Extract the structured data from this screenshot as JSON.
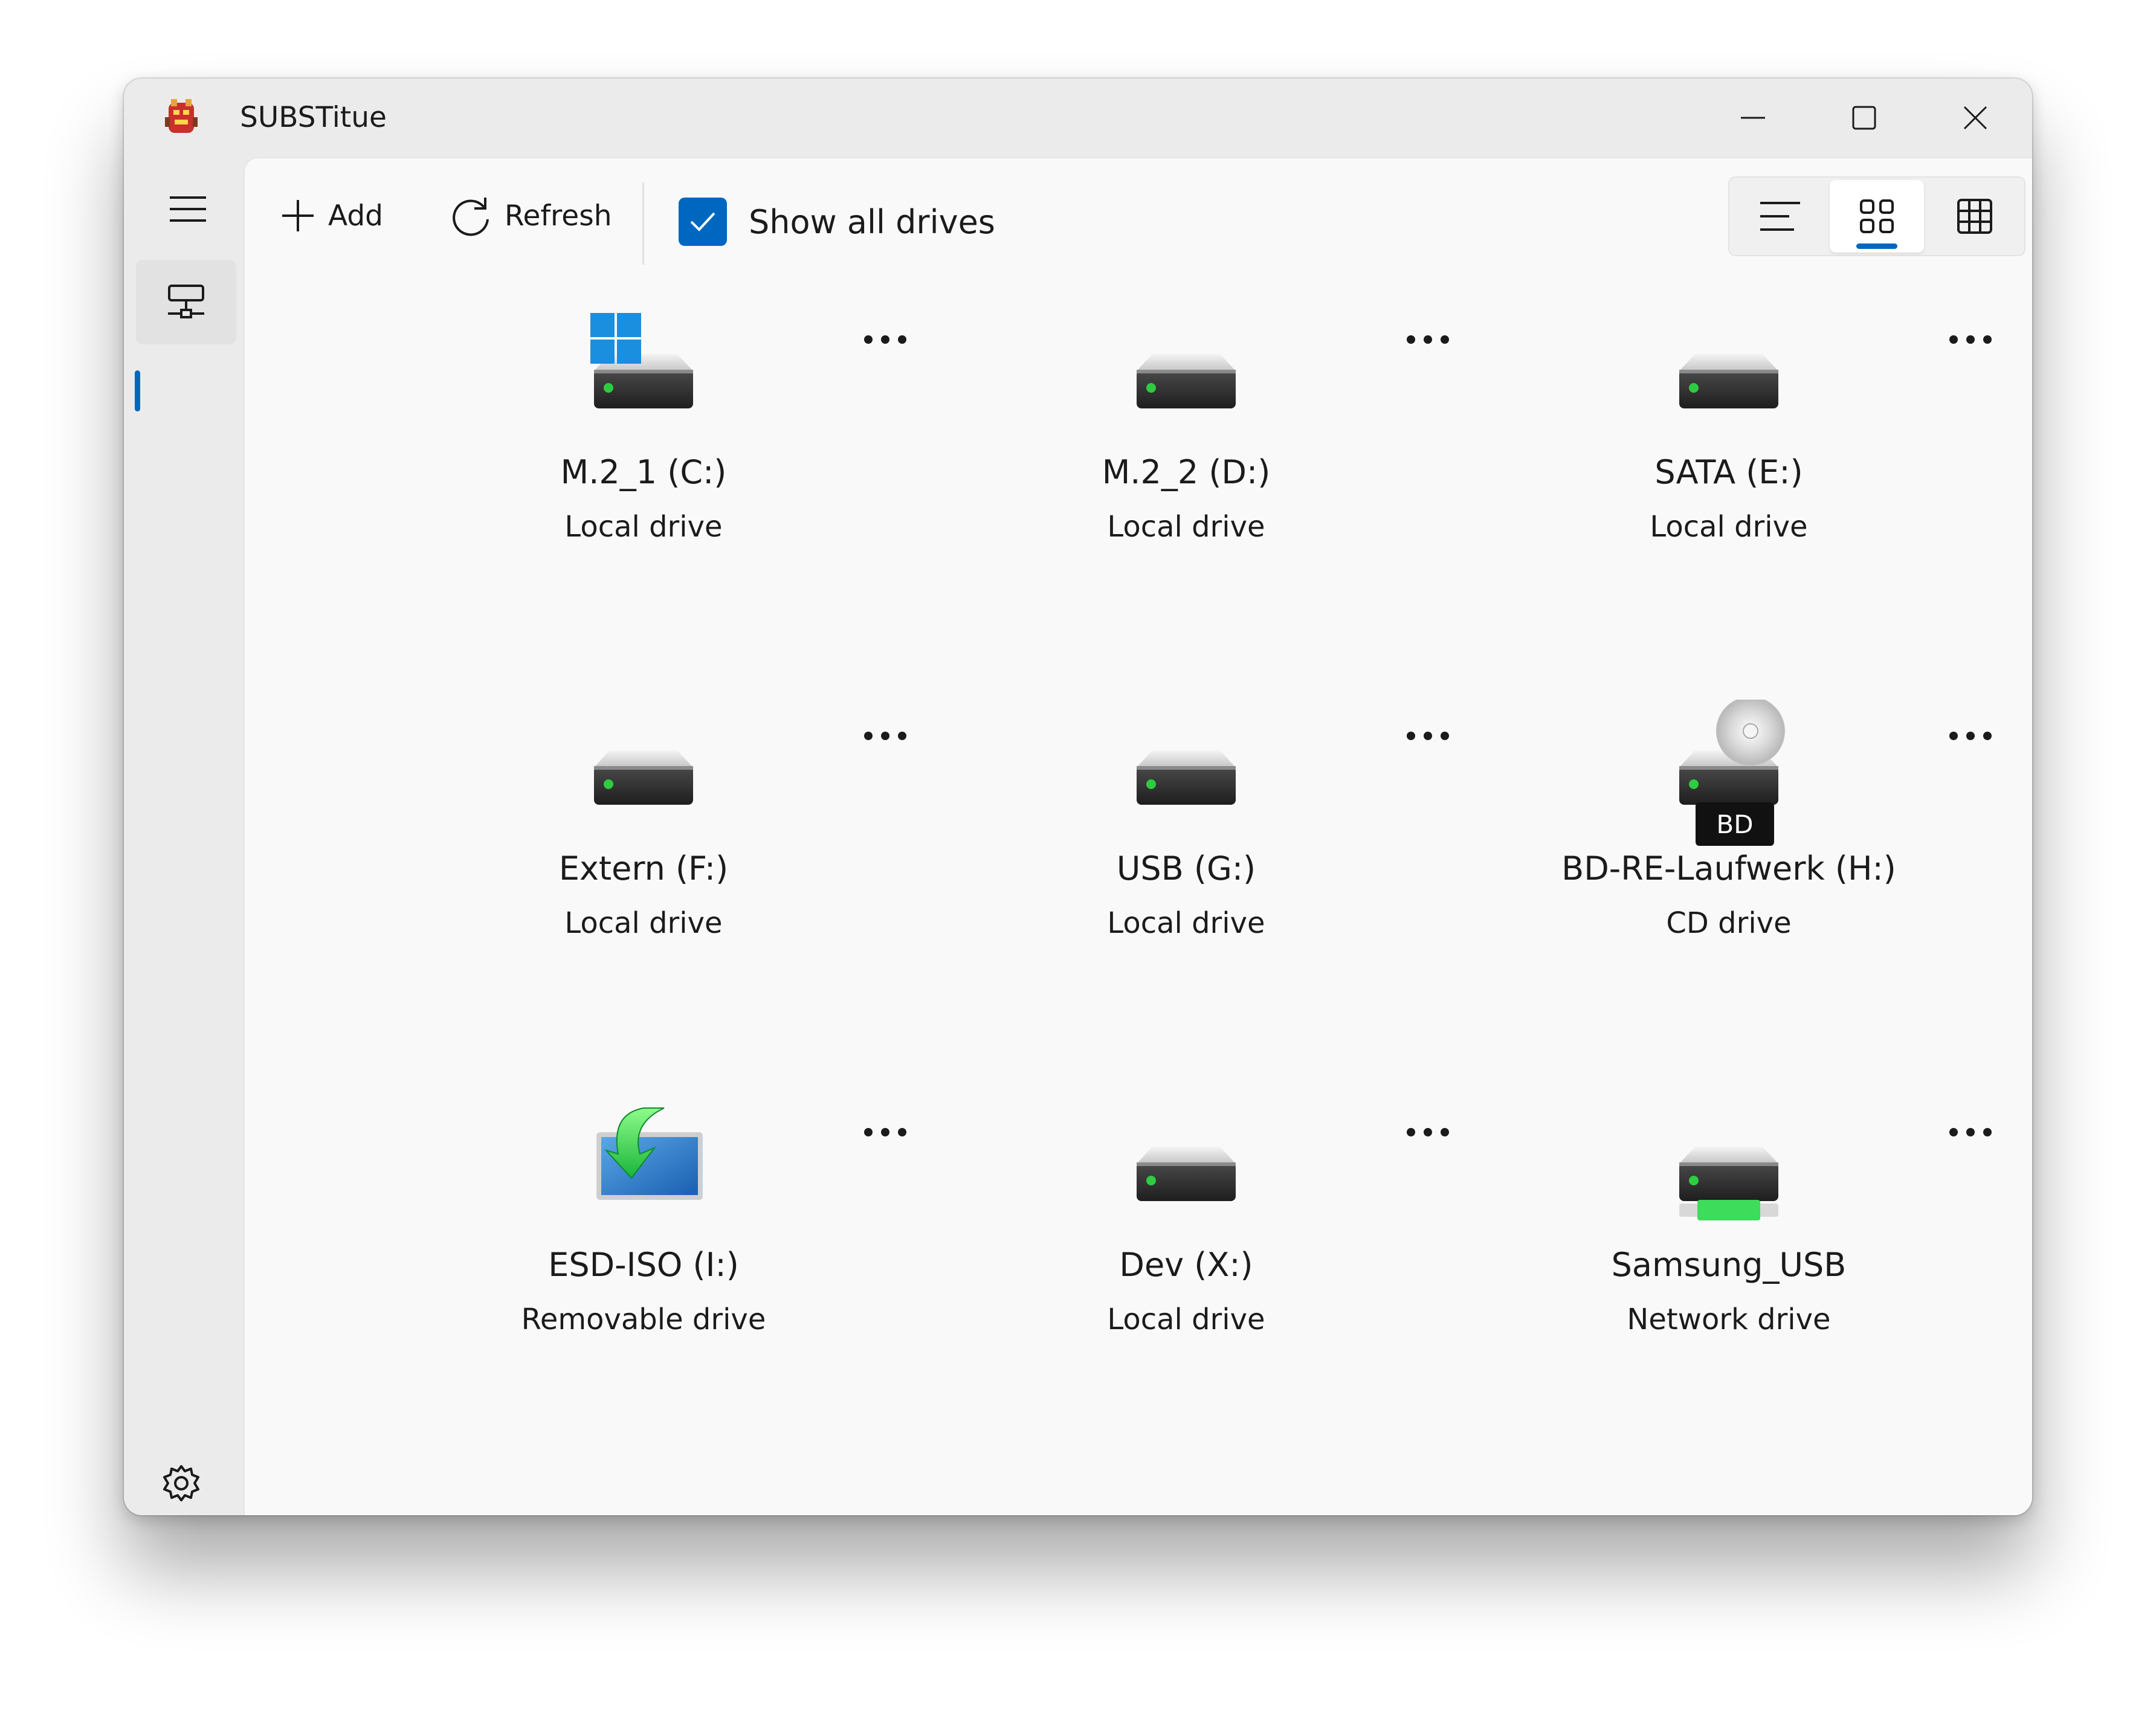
{
  "window": {
    "title": "SUBSTitue"
  },
  "toolbar": {
    "add_label": "Add",
    "refresh_label": "Refresh",
    "show_all_label": "Show all drives",
    "show_all_checked": true
  },
  "view_modes": {
    "options": [
      "list-view-icon",
      "tiles-view-icon",
      "grid-view-icon"
    ],
    "selected": "tiles-view-icon"
  },
  "drives": [
    {
      "name": "M.2_1 (C:)",
      "type": "Local drive",
      "icon": "system-drive-icon"
    },
    {
      "name": "M.2_2 (D:)",
      "type": "Local drive",
      "icon": "hard-drive-icon"
    },
    {
      "name": "SATA (E:)",
      "type": "Local drive",
      "icon": "hard-drive-icon"
    },
    {
      "name": "Extern (F:)",
      "type": "Local drive",
      "icon": "hard-drive-icon"
    },
    {
      "name": "USB (G:)",
      "type": "Local drive",
      "icon": "hard-drive-icon"
    },
    {
      "name": "BD-RE-Laufwerk (H:)",
      "type": "CD drive",
      "icon": "optical-drive-icon",
      "badge": "BD"
    },
    {
      "name": "ESD-ISO (I:)",
      "type": "Removable drive",
      "icon": "removable-drive-icon"
    },
    {
      "name": "Dev (X:)",
      "type": "Local drive",
      "icon": "hard-drive-icon"
    },
    {
      "name": "Samsung_USB",
      "type": "Network drive",
      "icon": "network-drive-icon"
    }
  ],
  "colors": {
    "accent": "#0067c0",
    "led": "#2ecc40",
    "network_green": "#3ddc5a"
  }
}
